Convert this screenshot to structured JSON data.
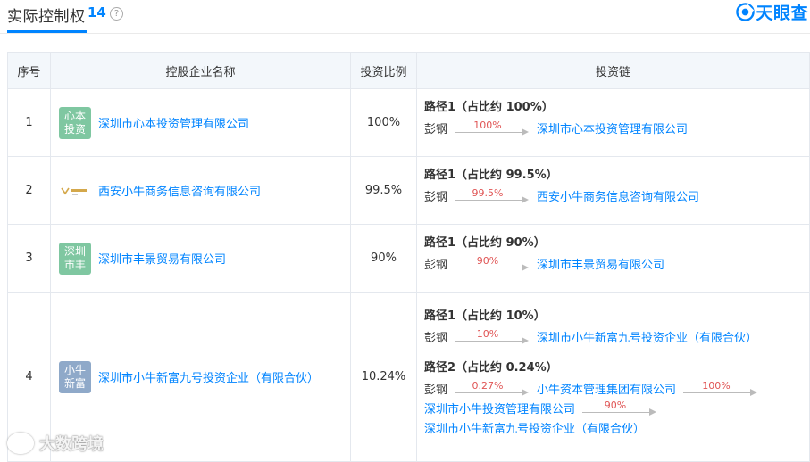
{
  "header": {
    "title": "实际控制权",
    "count": "14",
    "help_icon": "question-circle-icon",
    "brand": "天眼查",
    "brand_color": "#0084ff"
  },
  "table": {
    "columns": [
      "序号",
      "控股企业名称",
      "投资比例",
      "投资链"
    ],
    "rows": [
      {
        "index": "1",
        "badge": "心本\n投资",
        "badge_lines": [
          "心本",
          "投资"
        ],
        "company": "深圳市心本投资管理有限公司",
        "ratio": "100%",
        "paths": [
          {
            "title": "路径1（占比约 100%）",
            "chain": [
              {
                "type": "person",
                "text": "彭钢"
              },
              {
                "type": "arrow",
                "pct": "100%"
              },
              {
                "type": "company",
                "text": "深圳市心本投资管理有限公司"
              }
            ]
          }
        ]
      },
      {
        "index": "2",
        "badge": "logo",
        "badge_lines": [],
        "company": "西安小牛商务信息咨询有限公司",
        "ratio": "99.5%",
        "paths": [
          {
            "title": "路径1（占比约 99.5%）",
            "chain": [
              {
                "type": "person",
                "text": "彭钢"
              },
              {
                "type": "arrow",
                "pct": "99.5%"
              },
              {
                "type": "company",
                "text": "西安小牛商务信息咨询有限公司"
              }
            ]
          }
        ]
      },
      {
        "index": "3",
        "badge": "深圳\n市丰",
        "badge_lines": [
          "深圳",
          "市丰"
        ],
        "company": "深圳市丰景贸易有限公司",
        "ratio": "90%",
        "paths": [
          {
            "title": "路径1（占比约 90%）",
            "chain": [
              {
                "type": "person",
                "text": "彭钢"
              },
              {
                "type": "arrow",
                "pct": "90%"
              },
              {
                "type": "company",
                "text": "深圳市丰景贸易有限公司"
              }
            ]
          }
        ]
      },
      {
        "index": "4",
        "badge": "小牛\n新富",
        "badge_lines": [
          "小牛",
          "新富"
        ],
        "company": "深圳市小牛新富九号投资企业（有限合伙）",
        "ratio": "10.24%",
        "paths": [
          {
            "title": "路径1（占比约 10%）",
            "chain": [
              {
                "type": "person",
                "text": "彭钢"
              },
              {
                "type": "arrow",
                "pct": "10%"
              },
              {
                "type": "company",
                "text": "深圳市小牛新富九号投资企业（有限合伙）"
              }
            ]
          },
          {
            "title": "路径2（占比约 0.24%）",
            "chain": [
              {
                "type": "person",
                "text": "彭钢"
              },
              {
                "type": "arrow",
                "pct": "0.27%"
              },
              {
                "type": "company",
                "text": "小牛资本管理集团有限公司"
              },
              {
                "type": "arrow",
                "pct": "100%"
              },
              {
                "type": "company",
                "text": "深圳市小牛投资管理有限公司"
              },
              {
                "type": "arrow",
                "pct": "90%"
              },
              {
                "type": "company",
                "text": "深圳市小牛新富九号投资企业（有限合伙）"
              }
            ]
          }
        ]
      }
    ]
  },
  "watermark": "大数跨境"
}
